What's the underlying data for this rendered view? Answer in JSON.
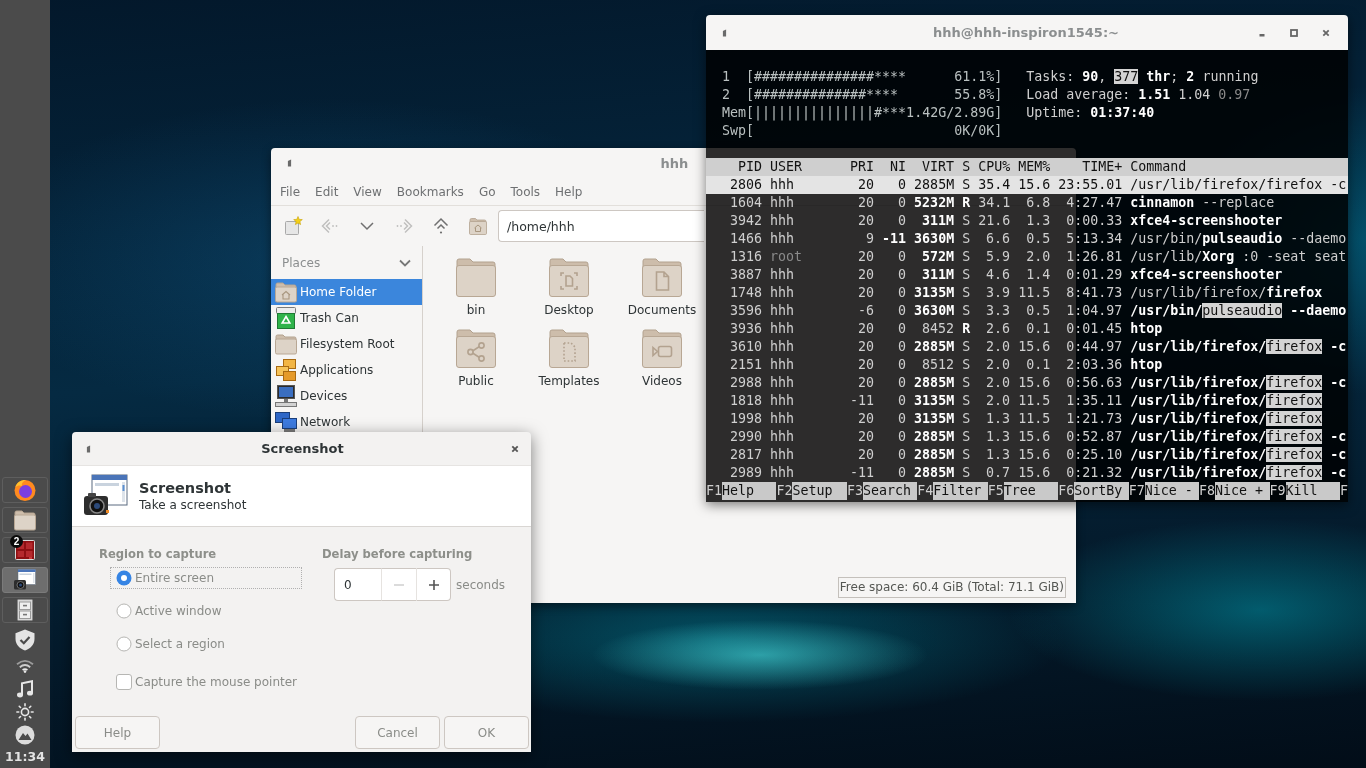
{
  "panel": {
    "launchers": [
      {
        "kind": "browser",
        "selected": false
      },
      {
        "kind": "folder",
        "selected": false
      },
      {
        "kind": "tiles",
        "selected": false,
        "badge": "2"
      },
      {
        "kind": "screenshot",
        "selected": true
      },
      {
        "kind": "cabinet",
        "selected": false
      }
    ],
    "tray": [
      {
        "kind": "shield"
      },
      {
        "kind": "wifi"
      },
      {
        "kind": "music"
      },
      {
        "kind": "brightness"
      },
      {
        "kind": "mountain"
      }
    ],
    "clock": "11:34"
  },
  "file_manager": {
    "title": "hhh",
    "menu": [
      "File",
      "Edit",
      "View",
      "Bookmarks",
      "Go",
      "Tools",
      "Help"
    ],
    "toolbar": [
      {
        "kind": "newtab",
        "disabled": false
      },
      {
        "kind": "back",
        "disabled": true
      },
      {
        "kind": "history",
        "disabled": false
      },
      {
        "kind": "forward",
        "disabled": true
      },
      {
        "kind": "up",
        "disabled": false
      },
      {
        "kind": "home",
        "disabled": false
      }
    ],
    "location": "/home/hhh",
    "places": {
      "header": "Places",
      "expanded": true,
      "items": [
        {
          "label": "Home Folder",
          "kind": "home",
          "selected": true
        },
        {
          "label": "Trash Can",
          "kind": "trash",
          "selected": false
        },
        {
          "label": "Filesystem Root",
          "kind": "drive",
          "selected": false
        },
        {
          "label": "Applications",
          "kind": "apps",
          "selected": false
        },
        {
          "label": "Devices",
          "kind": "computer",
          "selected": false
        },
        {
          "label": "Network",
          "kind": "network",
          "selected": false
        }
      ]
    },
    "files": [
      {
        "name": "bin",
        "kind": "plain"
      },
      {
        "name": "Desktop",
        "kind": "desktop"
      },
      {
        "name": "Documents",
        "kind": "documents"
      },
      {
        "name": "Public",
        "kind": "public"
      },
      {
        "name": "Templates",
        "kind": "templates"
      },
      {
        "name": "Videos",
        "kind": "videos"
      }
    ],
    "status": "Free space: 60.4 GiB (Total: 71.1 GiB)"
  },
  "terminal": {
    "title": "hhh@hhh-inspiron1545:~",
    "meters": [
      "1  [###############****      61.1%]",
      "2  [##############****       55.8%]",
      "Mem[|||||||||||||||#***1.42G/2.89G]",
      "Swp[                         0K/0K]"
    ],
    "summary": [
      [
        {
          "text": "Tasks: ",
          "kind": "plain"
        },
        {
          "text": "90",
          "kind": "strong"
        },
        {
          "text": ", ",
          "kind": "plain"
        },
        {
          "text": "377",
          "kind": "highlight"
        },
        {
          "text": " thr",
          "kind": "strong"
        },
        {
          "text": "; ",
          "kind": "plain"
        },
        {
          "text": "2",
          "kind": "strong"
        },
        {
          "text": " running",
          "kind": "plain"
        }
      ],
      [
        {
          "text": "Load average: ",
          "kind": "plain"
        },
        {
          "text": "1.51",
          "kind": "strong"
        },
        {
          "text": " 1.04",
          "kind": "plain"
        },
        {
          "text": " 0.97",
          "kind": "faint"
        }
      ],
      [
        {
          "text": "Uptime: ",
          "kind": "plain"
        },
        {
          "text": "01:37:40",
          "kind": "strong"
        }
      ]
    ],
    "columns": [
      "PID",
      "USER",
      "PRI",
      "NI",
      "VIRT",
      "S",
      "CPU%",
      "MEM%",
      "TIME+",
      "Command"
    ],
    "processes": [
      {
        "cells": [
          "2806",
          "hhh",
          "20",
          "0",
          "2885M",
          "S",
          "35.4",
          "15.6",
          "23:55.01"
        ],
        "command": [
          {
            "text": "/usr/lib/firefox/firefox -c",
            "kind": "plain"
          }
        ],
        "selected": true,
        "running": false,
        "high_priority": false,
        "large_memory": false,
        "system_user": false
      },
      {
        "cells": [
          "1604",
          "hhh",
          "20",
          "0",
          "5232M",
          "R",
          "34.1",
          "6.8",
          "4:27.47"
        ],
        "command": [
          {
            "text": "cinnamon",
            "kind": "strong"
          },
          {
            "text": " --replace",
            "kind": "plain"
          }
        ],
        "selected": false,
        "running": true,
        "high_priority": false,
        "large_memory": true,
        "system_user": false
      },
      {
        "cells": [
          "3942",
          "hhh",
          "20",
          "0",
          "311M",
          "S",
          "21.6",
          "1.3",
          "0:00.33"
        ],
        "command": [
          {
            "text": "xfce4-screenshooter",
            "kind": "strong"
          }
        ],
        "selected": false,
        "running": false,
        "high_priority": false,
        "large_memory": true,
        "system_user": false
      },
      {
        "cells": [
          "1466",
          "hhh",
          "9",
          "-11",
          "3630M",
          "S",
          "6.6",
          "0.5",
          "5:13.34"
        ],
        "command": [
          {
            "text": "/usr/bin/",
            "kind": "plain"
          },
          {
            "text": "pulseaudio",
            "kind": "strong"
          },
          {
            "text": " --daemo",
            "kind": "plain"
          }
        ],
        "selected": false,
        "running": false,
        "high_priority": true,
        "large_memory": true,
        "system_user": false
      },
      {
        "cells": [
          "1316",
          "root",
          "20",
          "0",
          "572M",
          "S",
          "5.9",
          "2.0",
          "1:26.81"
        ],
        "command": [
          {
            "text": "/usr/lib/",
            "kind": "plain"
          },
          {
            "text": "Xorg",
            "kind": "strong"
          },
          {
            "text": " :0 -seat seat",
            "kind": "plain"
          }
        ],
        "selected": false,
        "running": false,
        "high_priority": false,
        "large_memory": true,
        "system_user": true
      },
      {
        "cells": [
          "3887",
          "hhh",
          "20",
          "0",
          "311M",
          "S",
          "4.6",
          "1.4",
          "0:01.29"
        ],
        "command": [
          {
            "text": "xfce4-screenshooter",
            "kind": "strong"
          }
        ],
        "selected": false,
        "running": false,
        "high_priority": false,
        "large_memory": true,
        "system_user": false
      },
      {
        "cells": [
          "1748",
          "hhh",
          "20",
          "0",
          "3135M",
          "S",
          "3.9",
          "11.5",
          "8:41.73"
        ],
        "command": [
          {
            "text": "/usr/lib/firefox/",
            "kind": "plain"
          },
          {
            "text": "firefox",
            "kind": "strong"
          }
        ],
        "selected": false,
        "running": false,
        "high_priority": false,
        "large_memory": true,
        "system_user": false
      },
      {
        "cells": [
          "3596",
          "hhh",
          "-6",
          "0",
          "3630M",
          "S",
          "3.3",
          "0.5",
          "1:04.97"
        ],
        "command": [
          {
            "text": "/usr/bin/",
            "kind": "strong"
          },
          {
            "text": "pulseaudio",
            "kind": "highlight"
          },
          {
            "text": " --daemo",
            "kind": "strong"
          }
        ],
        "selected": false,
        "running": false,
        "high_priority": false,
        "large_memory": true,
        "system_user": false
      },
      {
        "cells": [
          "3936",
          "hhh",
          "20",
          "0",
          "8452",
          "R",
          "2.6",
          "0.1",
          "0:01.45"
        ],
        "command": [
          {
            "text": "htop",
            "kind": "strong"
          }
        ],
        "selected": false,
        "running": true,
        "high_priority": false,
        "large_memory": false,
        "system_user": false
      },
      {
        "cells": [
          "3610",
          "hhh",
          "20",
          "0",
          "2885M",
          "S",
          "2.0",
          "15.6",
          "0:44.97"
        ],
        "command": [
          {
            "text": "/usr/lib/firefox/",
            "kind": "strong"
          },
          {
            "text": "firefox",
            "kind": "highlight"
          },
          {
            "text": " -c",
            "kind": "strong"
          }
        ],
        "selected": false,
        "running": false,
        "high_priority": false,
        "large_memory": true,
        "system_user": false
      },
      {
        "cells": [
          "2151",
          "hhh",
          "20",
          "0",
          "8512",
          "S",
          "2.0",
          "0.1",
          "2:03.36"
        ],
        "command": [
          {
            "text": "htop",
            "kind": "strong"
          }
        ],
        "selected": false,
        "running": false,
        "high_priority": false,
        "large_memory": false,
        "system_user": false
      },
      {
        "cells": [
          "2988",
          "hhh",
          "20",
          "0",
          "2885M",
          "S",
          "2.0",
          "15.6",
          "0:56.63"
        ],
        "command": [
          {
            "text": "/usr/lib/firefox/",
            "kind": "strong"
          },
          {
            "text": "firefox",
            "kind": "highlight"
          },
          {
            "text": " -c",
            "kind": "strong"
          }
        ],
        "selected": false,
        "running": false,
        "high_priority": false,
        "large_memory": true,
        "system_user": false
      },
      {
        "cells": [
          "1818",
          "hhh",
          "-11",
          "0",
          "3135M",
          "S",
          "2.0",
          "11.5",
          "1:35.11"
        ],
        "command": [
          {
            "text": "/usr/lib/firefox/",
            "kind": "strong"
          },
          {
            "text": "firefox",
            "kind": "highlight"
          }
        ],
        "selected": false,
        "running": false,
        "high_priority": false,
        "large_memory": true,
        "system_user": false
      },
      {
        "cells": [
          "1998",
          "hhh",
          "20",
          "0",
          "3135M",
          "S",
          "1.3",
          "11.5",
          "1:21.73"
        ],
        "command": [
          {
            "text": "/usr/lib/firefox/",
            "kind": "strong"
          },
          {
            "text": "firefox",
            "kind": "highlight"
          }
        ],
        "selected": false,
        "running": false,
        "high_priority": false,
        "large_memory": true,
        "system_user": false
      },
      {
        "cells": [
          "2990",
          "hhh",
          "20",
          "0",
          "2885M",
          "S",
          "1.3",
          "15.6",
          "0:52.87"
        ],
        "command": [
          {
            "text": "/usr/lib/firefox/",
            "kind": "strong"
          },
          {
            "text": "firefox",
            "kind": "highlight"
          },
          {
            "text": " -c",
            "kind": "strong"
          }
        ],
        "selected": false,
        "running": false,
        "high_priority": false,
        "large_memory": true,
        "system_user": false
      },
      {
        "cells": [
          "2817",
          "hhh",
          "20",
          "0",
          "2885M",
          "S",
          "1.3",
          "15.6",
          "0:25.10"
        ],
        "command": [
          {
            "text": "/usr/lib/firefox/",
            "kind": "strong"
          },
          {
            "text": "firefox",
            "kind": "highlight"
          },
          {
            "text": " -c",
            "kind": "strong"
          }
        ],
        "selected": false,
        "running": false,
        "high_priority": false,
        "large_memory": true,
        "system_user": false
      },
      {
        "cells": [
          "2989",
          "hhh",
          "-11",
          "0",
          "2885M",
          "S",
          "0.7",
          "15.6",
          "0:21.32"
        ],
        "command": [
          {
            "text": "/usr/lib/firefox/",
            "kind": "strong"
          },
          {
            "text": "firefox",
            "kind": "highlight"
          },
          {
            "text": " -c",
            "kind": "strong"
          }
        ],
        "selected": false,
        "running": false,
        "high_priority": false,
        "large_memory": true,
        "system_user": false
      }
    ],
    "function_keys": [
      {
        "key": "F1",
        "label": "Help"
      },
      {
        "key": "F2",
        "label": "Setup"
      },
      {
        "key": "F3",
        "label": "Search"
      },
      {
        "key": "F4",
        "label": "Filter"
      },
      {
        "key": "F5",
        "label": "Tree"
      },
      {
        "key": "F6",
        "label": "SortBy"
      },
      {
        "key": "F7",
        "label": "Nice -"
      },
      {
        "key": "F8",
        "label": "Nice +"
      },
      {
        "key": "F9",
        "label": "Kill"
      },
      {
        "key": "F"
      }
    ]
  },
  "screenshot_dialog": {
    "title": "Screenshot",
    "heading": "Screenshot",
    "subtitle": "Take a screenshot",
    "region": {
      "header": "Region to capture",
      "options": [
        {
          "label": "Entire screen",
          "selected": true,
          "focused": true
        },
        {
          "label": "Active window",
          "selected": false,
          "focused": false
        },
        {
          "label": "Select a region",
          "selected": false,
          "focused": false
        }
      ],
      "pointer": {
        "label": "Capture the mouse pointer",
        "checked": false
      }
    },
    "delay": {
      "header": "Delay before capturing",
      "value": "0",
      "steppers": [
        {
          "kind": "minus",
          "disabled": true
        },
        {
          "kind": "plus",
          "disabled": false
        }
      ],
      "unit": "seconds"
    },
    "help": "Help",
    "buttons": [
      "Cancel",
      "OK"
    ]
  }
}
